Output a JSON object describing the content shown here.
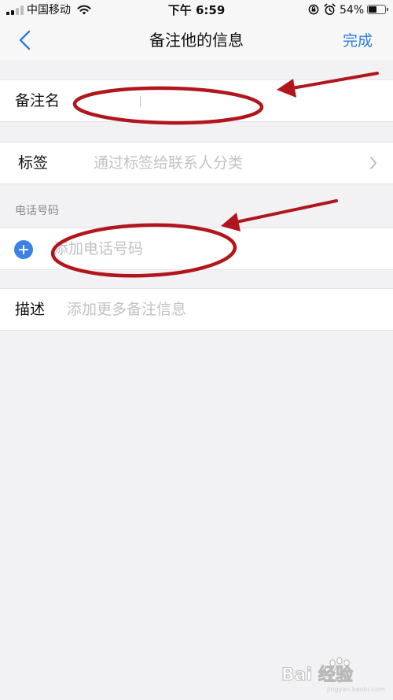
{
  "status_bar": {
    "carrier": "中国移动",
    "time": "下午 6:59",
    "battery_percent_text": "54%",
    "battery_level": 0.54
  },
  "nav": {
    "back_icon": "chevron-left-icon",
    "title": "备注他的信息",
    "done_label": "完成"
  },
  "form": {
    "remark_name": {
      "label": "备注名",
      "value": ""
    },
    "tags": {
      "label": "标签",
      "placeholder": "通过标签给联系人分类",
      "icon": "chevron-right-icon"
    },
    "phone": {
      "section_title": "电话号码",
      "add_placeholder": "添加电话号码",
      "icon": "plus-circle-icon"
    },
    "description": {
      "label": "描述",
      "placeholder": "添加更多备注信息"
    }
  },
  "colors": {
    "accent": "#2c7be5",
    "add_icon": "#3b82e6",
    "annotation": "#b0161c",
    "background": "#f2f2f5"
  },
  "watermark": {
    "text": "Bai 经验",
    "subtext": "jingyan.baidu.com"
  }
}
